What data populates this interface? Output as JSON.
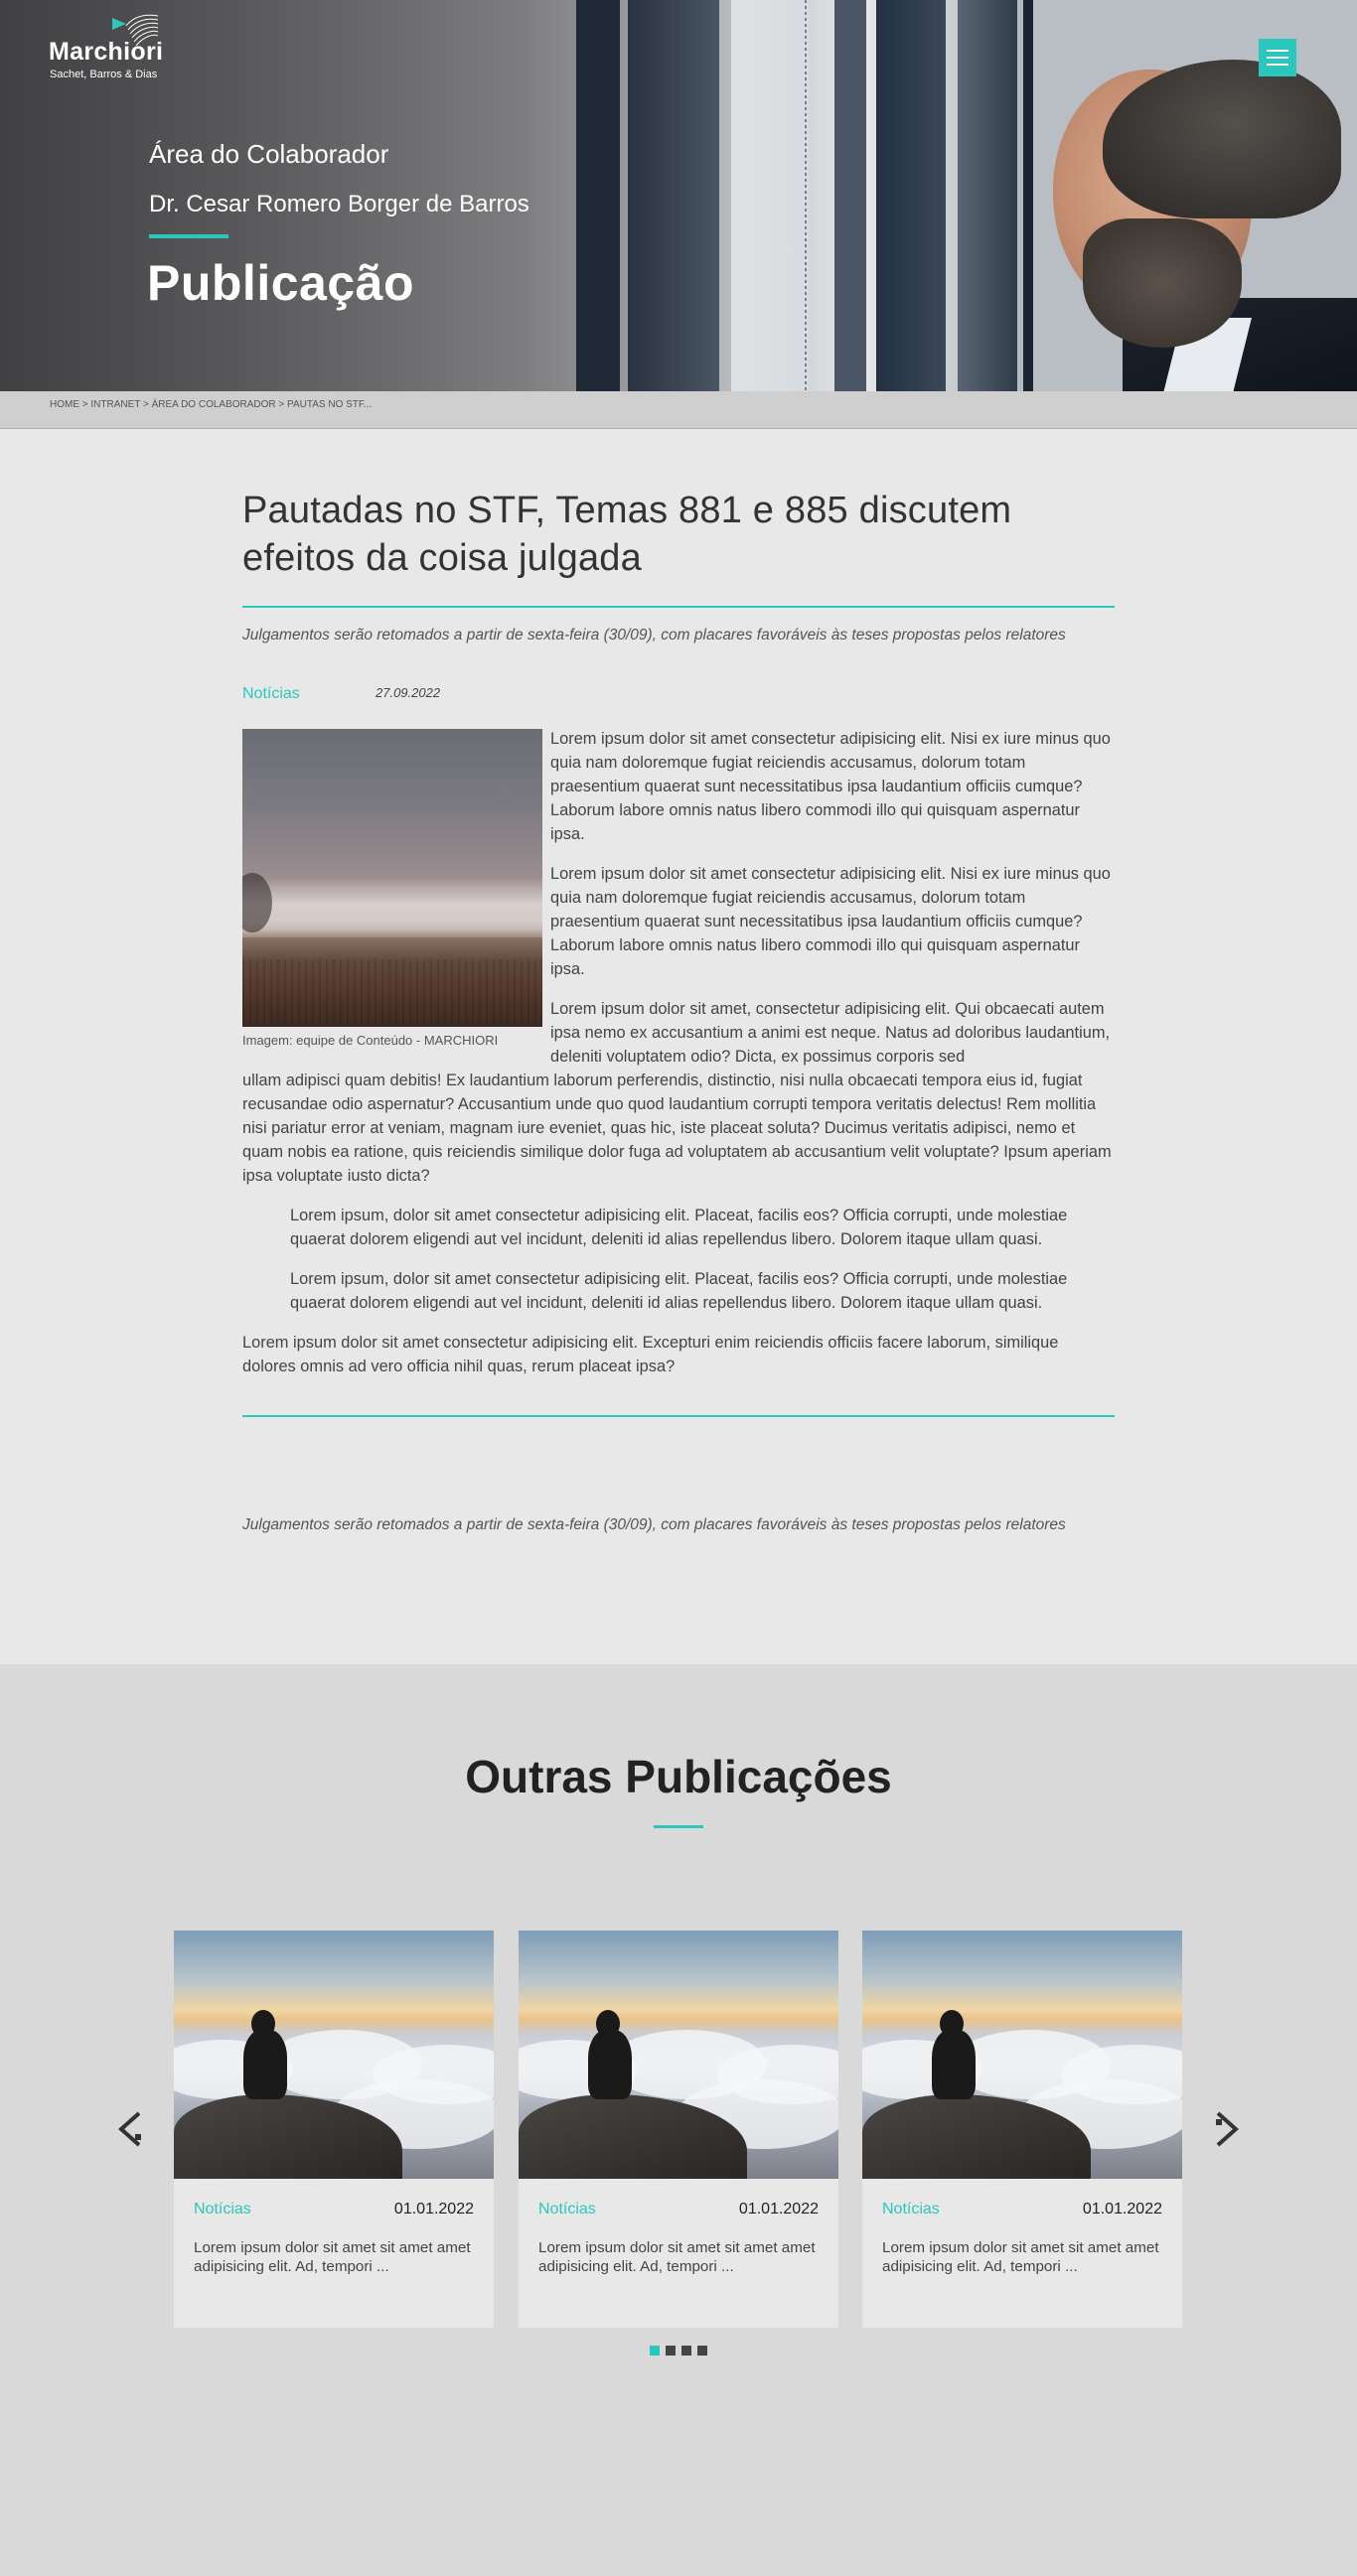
{
  "brand": {
    "name": "Marchiori",
    "subtitle": "Sachet, Barros & Dias",
    "accent_color": "#2bc7bd"
  },
  "header": {
    "area": "Área do Colaborador",
    "user": "Dr. Cesar Romero Borger de Barros",
    "page_title": "Publicação",
    "menu_icon": "hamburger-icon"
  },
  "breadcrumb": {
    "text": "HOME > INTRANET > ÁREA DO COLABORADOR > PAUTAS NO STF..."
  },
  "article": {
    "title_line1": "Pautadas no STF, Temas 881 e 885 discutem",
    "title_line2": "efeitos da coisa  julgada",
    "subtitle": "Julgamentos serão retomados a partir de sexta-feira (30/09), com placares favoráveis às teses propostas pelos relatores",
    "category": "Notícias",
    "date": "27.09.2022",
    "image_caption": "Imagem: equipe de Conteúdo - MARCHIORI",
    "paragraph1": "Lorem ipsum dolor sit amet consectetur adipisicing elit. Nisi ex iure minus quo quia nam doloremque fugiat reiciendis accusamus, dolorum totam praesentium quaerat sunt necessitatibus ipsa laudantium officiis cumque? Laborum labore omnis natus libero commodi illo qui quisquam aspernatur ipsa.",
    "paragraph2": "Lorem ipsum dolor sit amet consectetur adipisicing elit. Nisi ex iure minus quo quia nam doloremque fugiat reiciendis accusamus, dolorum totam praesentium quaerat sunt necessitatibus ipsa laudantium officiis cumque? Laborum labore omnis natus libero commodi illo qui quisquam aspernatur ipsa.",
    "paragraph3_wrap": "Lorem ipsum dolor sit amet, consectetur adipisicing elit. Qui obcaecati autem ipsa nemo ex accusantium a animi est neque. Natus ad doloribus laudantium, deleniti voluptatem odio? Dicta, ex possimus corporis sed",
    "paragraph3_full": "ullam adipisci quam debitis! Ex laudantium laborum perferendis, distinctio, nisi nulla obcaecati tempora eius id, fugiat recusandae odio aspernatur? Accusantium unde quo quod laudantium corrupti tempora veritatis delectus! Rem mollitia nisi pariatur error at veniam, magnam iure eveniet, quas hic, iste placeat soluta? Ducimus veritatis adipisci, nemo et quam nobis ea ratione, quis reiciendis similique dolor fuga ad voluptatem ab accusantium velit voluptate? Ipsum aperiam ipsa voluptate iusto dicta?",
    "quote1": "Lorem ipsum, dolor sit amet consectetur adipisicing elit. Placeat, facilis eos? Officia corrupti, unde molestiae quaerat dolorem eligendi aut vel incidunt, deleniti id alias repellendus libero. Dolorem itaque ullam quasi.",
    "quote2": "Lorem ipsum, dolor sit amet consectetur adipisicing elit. Placeat, facilis eos? Officia corrupti, unde molestiae quaerat dolorem eligendi aut vel incidunt, deleniti id alias repellendus libero. Dolorem itaque ullam quasi.",
    "paragraph4": "Lorem ipsum dolor sit amet consectetur adipisicing elit. Excepturi enim reiciendis officiis facere laborum, similique dolores omnis ad vero officia nihil quas, rerum placeat ipsa?",
    "footer_subtitle": "Julgamentos serão retomados a partir de sexta-feira (30/09), com placares favoráveis às teses propostas pelos relatores"
  },
  "others": {
    "title": "Outras Publicações",
    "cards": [
      {
        "category": "Notícias",
        "date": "01.01.2022",
        "text": "Lorem ipsum dolor sit amet sit amet amet adipisicing elit. Ad, tempori ..."
      },
      {
        "category": "Notícias",
        "date": "01.01.2022",
        "text": "Lorem ipsum dolor sit amet sit amet amet adipisicing elit. Ad, tempori ..."
      },
      {
        "category": "Notícias",
        "date": "01.01.2022",
        "text": "Lorem ipsum dolor sit amet sit amet amet adipisicing elit. Ad, tempori ..."
      }
    ],
    "prev_icon": "chevron-left-icon",
    "next_icon": "chevron-right-icon",
    "pagination": {
      "pages": 4,
      "active": 1
    }
  }
}
